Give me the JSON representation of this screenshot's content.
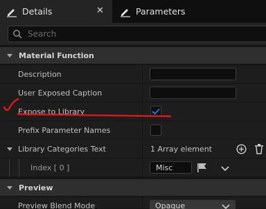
{
  "tabs": [
    {
      "label": "Details",
      "icon": "pencil-icon",
      "active": true
    },
    {
      "label": "Parameters",
      "icon": "pencil-icon",
      "active": false
    }
  ],
  "search": {
    "placeholder": "Search"
  },
  "categories": {
    "material_function": "Material Function",
    "preview": "Preview"
  },
  "properties": {
    "description": {
      "label": "Description",
      "value": ""
    },
    "user_exposed_caption": {
      "label": "User Exposed Caption",
      "value": ""
    },
    "expose_to_library": {
      "label": "Expose to Library",
      "checked": true
    },
    "prefix_parameter_names": {
      "label": "Prefix Parameter Names",
      "checked": false
    },
    "library_categories_text": {
      "label": "Library Categories Text",
      "value": "1 Array element"
    },
    "index_0": {
      "label": "Index [ 0 ]",
      "value": "Misc"
    },
    "preview_blend_mode": {
      "label": "Preview Blend Mode",
      "value": "Opaque"
    }
  },
  "colors": {
    "accent": "#1e6ec8",
    "annotation": "#e0171c"
  }
}
